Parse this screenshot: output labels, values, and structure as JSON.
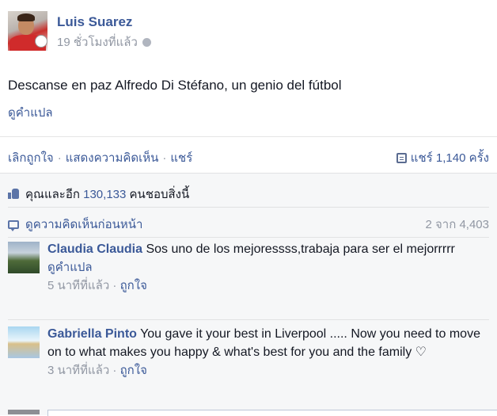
{
  "post": {
    "author": "Luis Suarez",
    "time": "19 ชั่วโมงที่แล้ว",
    "text": "Descanse en paz Alfredo Di Stéfano, un genio del fútbol",
    "translate_label": "ดูคำแปล"
  },
  "actions": {
    "unlike": "เลิกถูกใจ",
    "comment": "แสดงความคิดเห็น",
    "share": "แชร์",
    "separator": "·",
    "share_count": "แชร์ 1,140 ครั้ง"
  },
  "likes": {
    "prefix": "คุณและอีก ",
    "count": "130,133",
    "suffix": " คนชอบสิ่งนี้"
  },
  "previous_comments": {
    "label": "ดูความคิดเห็นก่อนหน้า",
    "count": "2 จาก 4,403"
  },
  "comments": [
    {
      "name": "Claudia Claudia",
      "text": "Sos uno de los mejoressss,trabaja para ser el mejorrrrr",
      "translate_label": "ดูคำแปล",
      "time": "5 นาทีที่แล้ว",
      "like_label": "ถูกใจ"
    },
    {
      "name": "Gabriella Pinto",
      "text": "You gave it your best in Liverpool ..... Now you need to move on to what makes you happy & what's best for you and the family ♡",
      "time": "3 นาทีที่แล้ว",
      "like_label": "ถูกใจ"
    }
  ]
}
